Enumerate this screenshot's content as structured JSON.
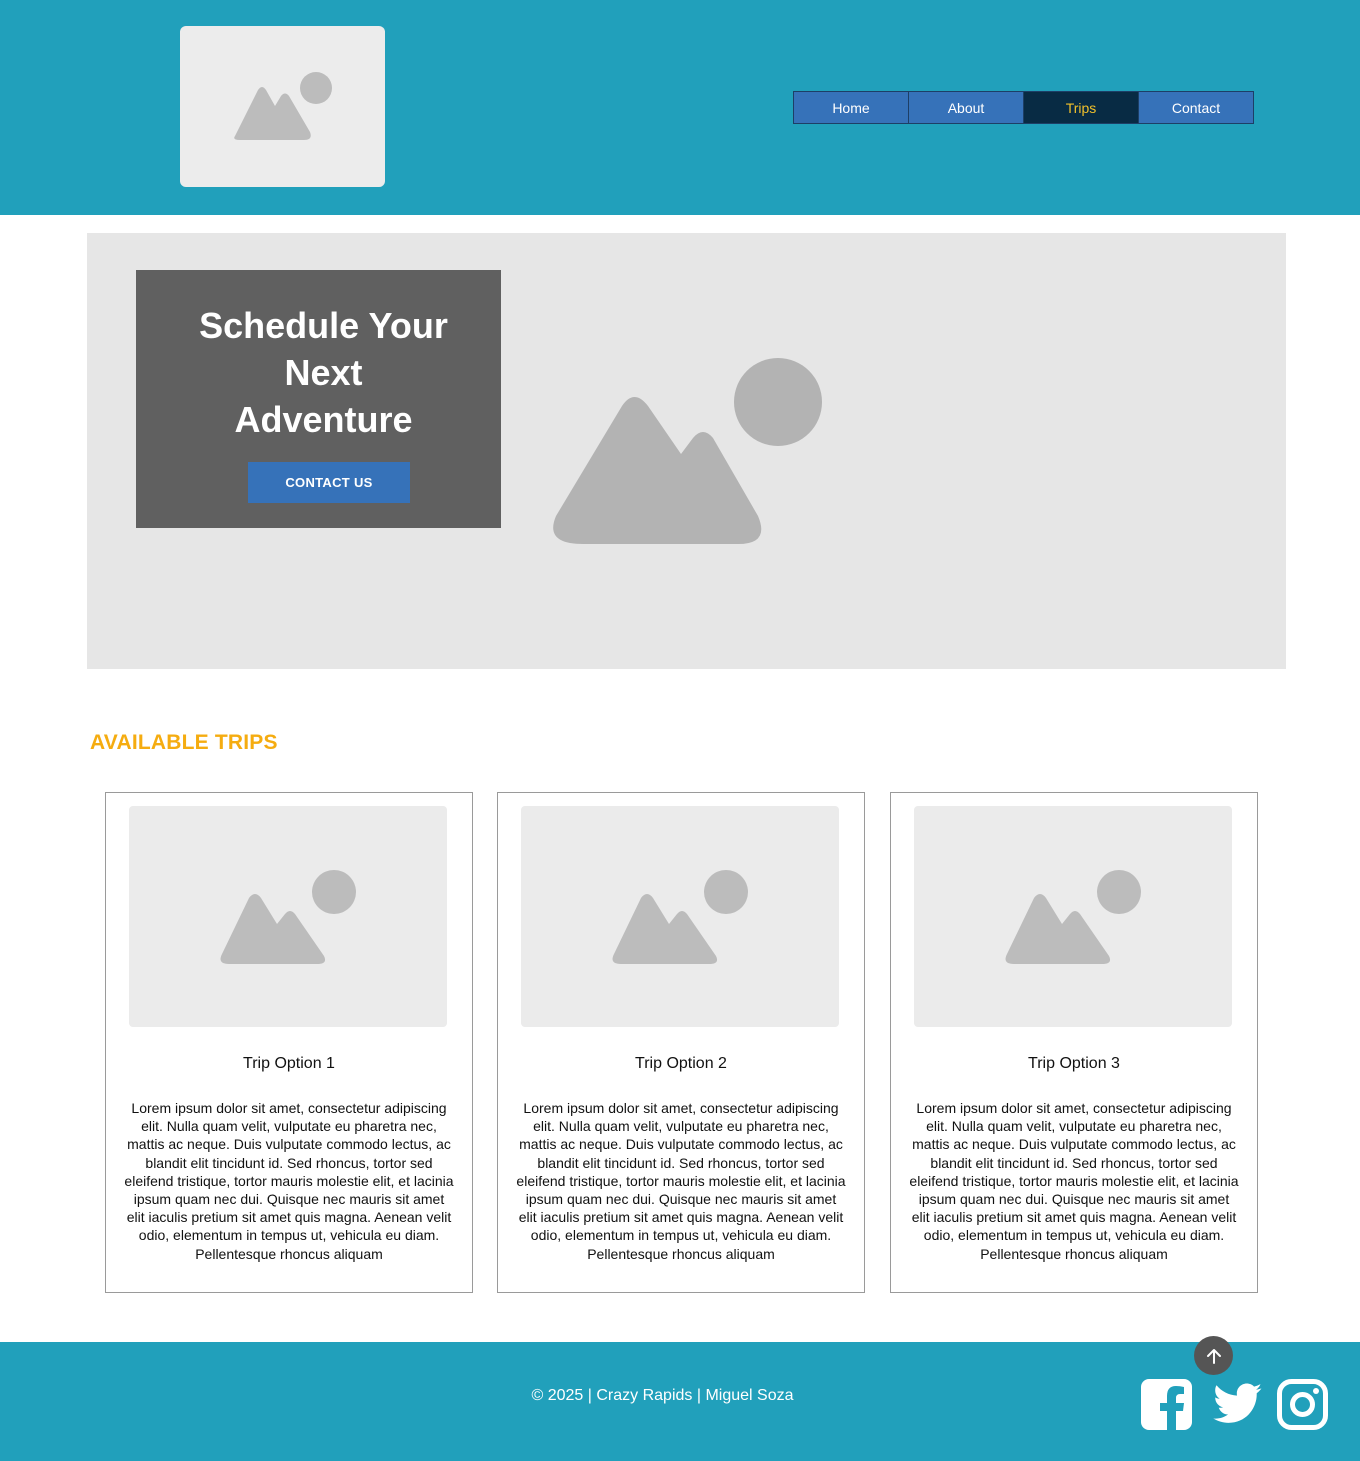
{
  "header": {
    "logo_icon": "image-placeholder-icon",
    "nav": [
      {
        "label": "Home",
        "active": false
      },
      {
        "label": "About",
        "active": false
      },
      {
        "label": "Trips",
        "active": true
      },
      {
        "label": "Contact",
        "active": false
      }
    ]
  },
  "hero": {
    "title_line1": "Schedule Your",
    "title_line2": "Next",
    "title_line3": "Adventure",
    "button_label": "CONTACT US",
    "image_icon": "image-placeholder-icon"
  },
  "trips": {
    "heading": "AVAILABLE TRIPS",
    "cards": [
      {
        "title": "Trip Option 1",
        "text": "Lorem ipsum dolor sit amet, consectetur adipiscing elit. Nulla quam velit, vulputate eu pharetra nec, mattis ac neque. Duis vulputate commodo lectus, ac blandit elit tincidunt id. Sed rhoncus, tortor sed eleifend tristique, tortor mauris molestie elit, et lacinia ipsum quam nec dui. Quisque nec mauris sit amet elit iaculis pretium sit amet quis magna. Aenean velit odio, elementum in tempus ut, vehicula eu diam. Pellentesque rhoncus aliquam"
      },
      {
        "title": "Trip Option 2",
        "text": "Lorem ipsum dolor sit amet, consectetur adipiscing elit. Nulla quam velit, vulputate eu pharetra nec, mattis ac neque. Duis vulputate commodo lectus, ac blandit elit tincidunt id. Sed rhoncus, tortor sed eleifend tristique, tortor mauris molestie elit, et lacinia ipsum quam nec dui. Quisque nec mauris sit amet elit iaculis pretium sit amet quis magna. Aenean velit odio, elementum in tempus ut, vehicula eu diam. Pellentesque rhoncus aliquam"
      },
      {
        "title": "Trip Option 3",
        "text": "Lorem ipsum dolor sit amet, consectetur adipiscing elit. Nulla quam velit, vulputate eu pharetra nec, mattis ac neque. Duis vulputate commodo lectus, ac blandit elit tincidunt id. Sed rhoncus, tortor sed eleifend tristique, tortor mauris molestie elit, et lacinia ipsum quam nec dui. Quisque nec mauris sit amet elit iaculis pretium sit amet quis magna. Aenean velit odio, elementum in tempus ut, vehicula eu diam. Pellentesque rhoncus aliquam"
      }
    ]
  },
  "footer": {
    "copyright": "© 2025 | Crazy Rapids | Miguel Soza",
    "back_to_top_icon": "arrow-up-icon",
    "social_icons": [
      "facebook-icon",
      "twitter-icon",
      "instagram-icon"
    ]
  },
  "colors": {
    "header_bg": "#21a0bb",
    "nav_bg": "#3672b9",
    "nav_active_bg": "#082b44",
    "nav_active_text": "#f0c02b",
    "heading_accent": "#f5ac10",
    "hero_box_bg": "#606060"
  }
}
